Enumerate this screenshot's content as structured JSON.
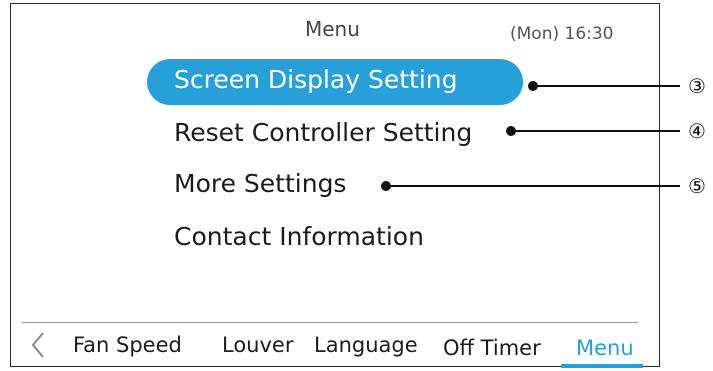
{
  "header": {
    "title": "Menu",
    "clock": "(Mon) 16:30"
  },
  "menu": {
    "items": [
      {
        "label": "Screen Display Setting",
        "selected": true
      },
      {
        "label": "Reset Controller Setting",
        "selected": false
      },
      {
        "label": "More Settings",
        "selected": false
      },
      {
        "label": "Contact Information",
        "selected": false
      }
    ]
  },
  "tabs": {
    "back_icon": "chevron-left-icon",
    "items": [
      {
        "label": "Fan Speed"
      },
      {
        "label": "Louver"
      },
      {
        "label": "Language"
      },
      {
        "label": "Off Timer"
      },
      {
        "label": "Menu",
        "active": true
      }
    ]
  },
  "callouts": [
    "③",
    "④",
    "⑤"
  ],
  "colors": {
    "accent": "#27a0d9",
    "text": "#1c1c1c"
  }
}
